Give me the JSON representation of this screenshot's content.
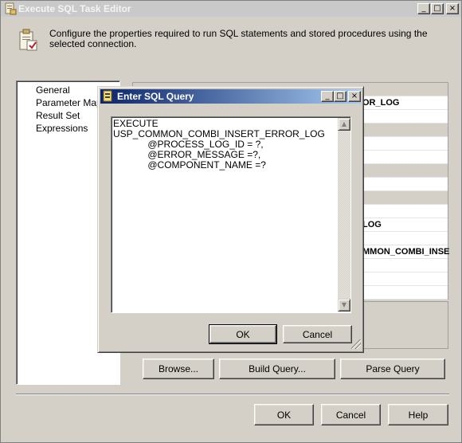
{
  "main_window": {
    "title": "Execute SQL Task Editor",
    "header_text": "Configure the properties required to run SQL statements and stored procedures using the selected connection.",
    "caption_buttons": {
      "minimize": "_",
      "maximize": "□",
      "close": "×"
    }
  },
  "nav": {
    "items": [
      {
        "label": "General"
      },
      {
        "label": "Parameter Mapping"
      },
      {
        "label": "Result Set"
      },
      {
        "label": "Expressions"
      }
    ]
  },
  "grid": {
    "visible_values": [
      "OR_LOG",
      "LOG",
      "MMON_COMBI_INSE"
    ]
  },
  "bottom_buttons": {
    "browse": "Browse...",
    "build_query": "Build Query...",
    "parse_query": "Parse Query"
  },
  "footer_buttons": {
    "ok": "OK",
    "cancel": "Cancel",
    "help": "Help"
  },
  "dialog": {
    "title": "Enter SQL Query",
    "query": "EXECUTE \nUSP_COMMON_COMBI_INSERT_ERROR_LOG\n             @PROCESS_LOG_ID = ?,\n             @ERROR_MESSAGE =?,\n             @COMPONENT_NAME =?",
    "ok_label": "OK",
    "cancel_label": "Cancel",
    "caption_buttons": {
      "minimize": "_",
      "maximize": "□",
      "close": "×"
    }
  }
}
